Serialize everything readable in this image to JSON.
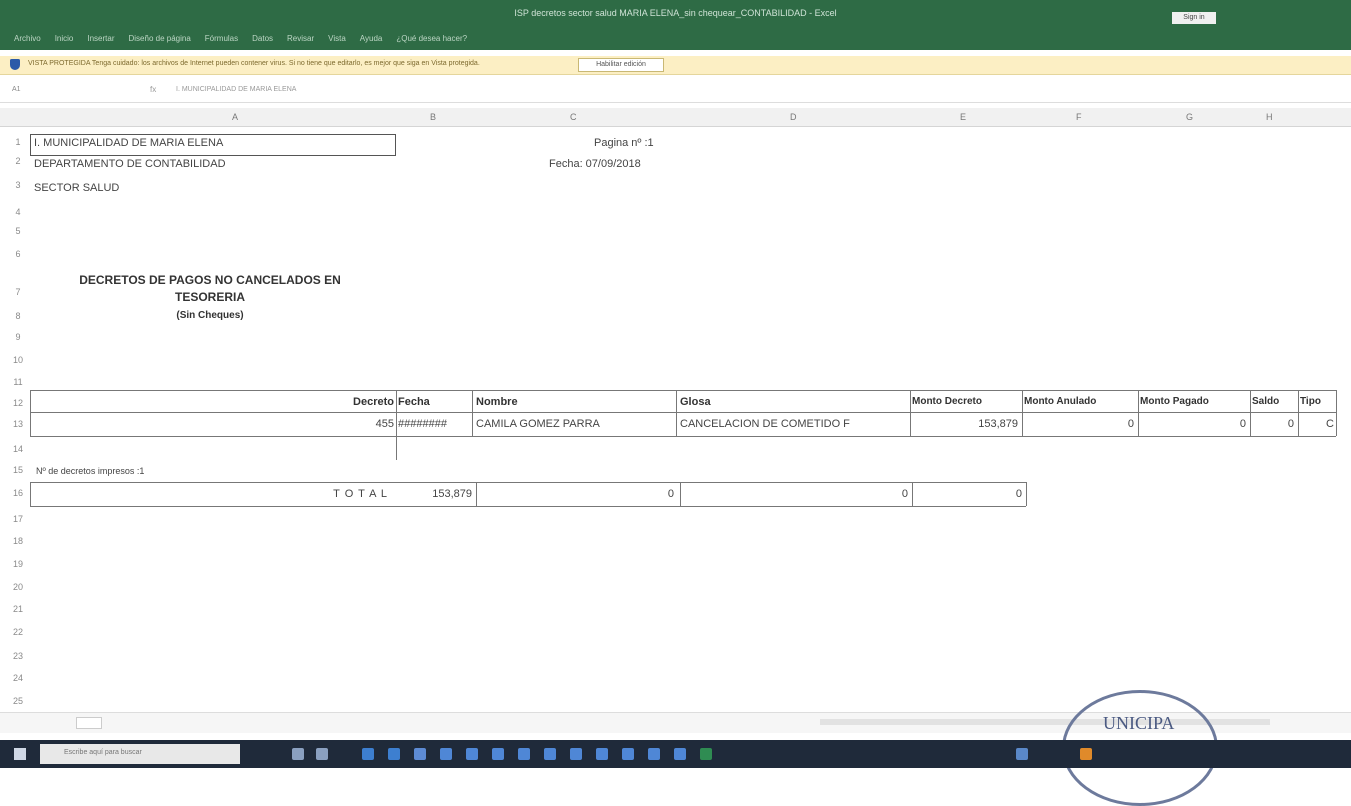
{
  "window": {
    "title": "ISP decretos sector salud MARIA ELENA_sin chequear_CONTABILIDAD - Excel",
    "signin": "Sign in"
  },
  "ribbon": {
    "tabs": [
      "Archivo",
      "Inicio",
      "Insertar",
      "Diseño de página",
      "Fórmulas",
      "Datos",
      "Revisar",
      "Vista",
      "Ayuda",
      "¿Qué desea hacer?"
    ]
  },
  "protected_view": {
    "message": "VISTA PROTEGIDA  Tenga cuidado: los archivos de Internet pueden contener virus. Si no tiene que editarlo, es mejor que siga en Vista protegida.",
    "button": "Habilitar edición"
  },
  "formula_bar": {
    "name_box": "A1",
    "fx": "fx",
    "value": "I. MUNICIPALIDAD DE MARIA ELENA"
  },
  "columns": [
    "A",
    "B",
    "C",
    "D",
    "E",
    "F",
    "G",
    "H"
  ],
  "rows": [
    "1",
    "2",
    "3",
    "4",
    "5",
    "6",
    "7",
    "8",
    "9",
    "10",
    "11",
    "12",
    "13",
    "14",
    "15",
    "16",
    "17",
    "18",
    "19",
    "20",
    "21",
    "22",
    "23",
    "24",
    "25"
  ],
  "sheet": {
    "org1": "I. MUNICIPALIDAD DE MARIA ELENA",
    "org2": "DEPARTAMENTO DE CONTABILIDAD",
    "org3": "SECTOR SALUD",
    "page": "Pagina nº :1",
    "date": "Fecha: 07/09/2018",
    "title1": "DECRETOS DE PAGOS NO CANCELADOS EN",
    "title2": "TESORERIA",
    "title3": "(Sin Cheques)",
    "headers": {
      "decreto": "Decreto",
      "fecha": "Fecha",
      "nombre": "Nombre",
      "glosa": "Glosa",
      "monto_decreto": "Monto Decreto",
      "monto_anulado": "Monto Anulado",
      "monto_pagado": "Monto Pagado",
      "saldo": "Saldo",
      "tipo": "Tipo"
    },
    "row": {
      "decreto": "455",
      "fecha": "########",
      "nombre": "CAMILA GOMEZ PARRA",
      "glosa": "CANCELACION DE COMETIDO F",
      "monto_decreto": "153,879",
      "monto_anulado": "0",
      "monto_pagado": "0",
      "saldo": "0",
      "tipo": "C"
    },
    "count": "Nº de decretos impresos :1",
    "total_label": "T O T A L",
    "totals": [
      "153,879",
      "0",
      "0",
      "0"
    ]
  },
  "taskbar": {
    "search_placeholder": "Escribe aquí para buscar"
  },
  "stamp_text": "UNICIPA"
}
